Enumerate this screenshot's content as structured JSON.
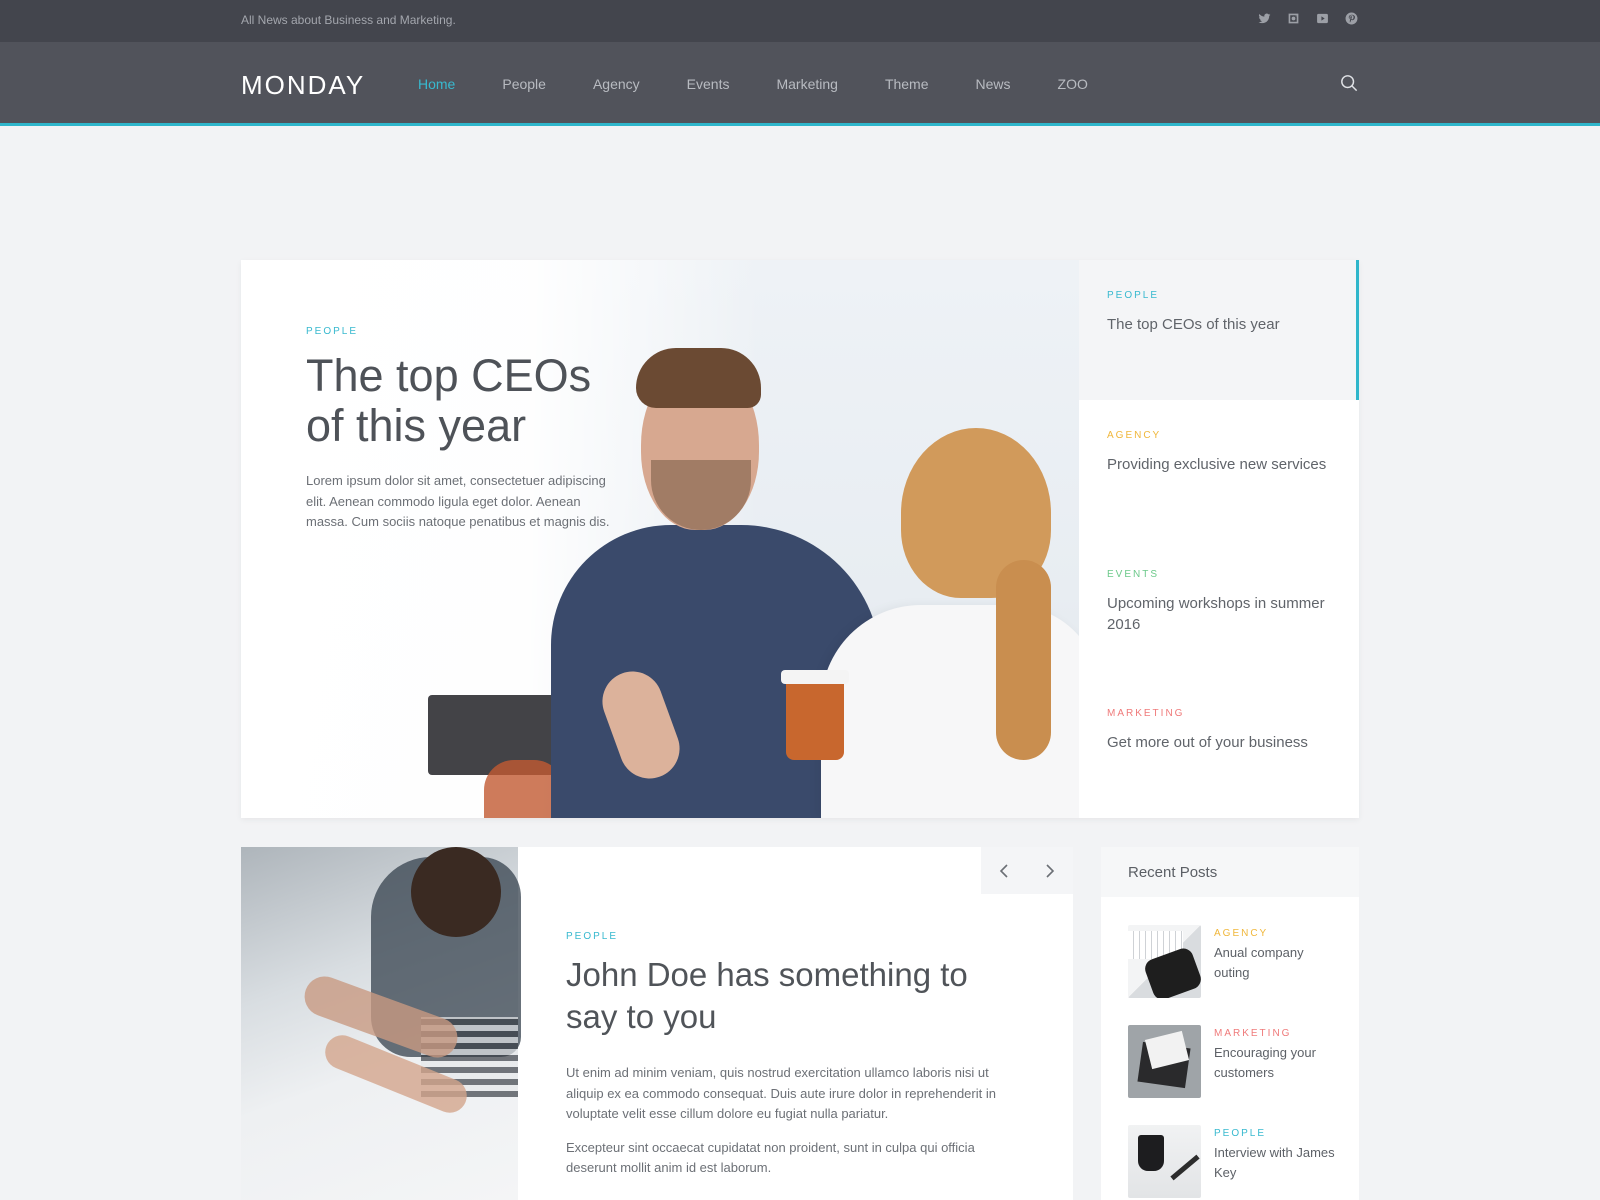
{
  "topbar": {
    "tagline": "All News about Business and Marketing.",
    "social": [
      "twitter-icon",
      "instagram-icon",
      "youtube-icon",
      "pinterest-icon"
    ]
  },
  "nav": {
    "logo": "MONDAY",
    "items": [
      "Home",
      "People",
      "Agency",
      "Events",
      "Marketing",
      "Theme",
      "News",
      "ZOO"
    ],
    "active": "Home",
    "search_icon": "search-icon"
  },
  "colors": {
    "accent": "#2fb6cb",
    "people": "#38b9cf",
    "agency": "#f0b73b",
    "events": "#6cc98a",
    "marketing": "#ef7a7a"
  },
  "hero": {
    "category": "PEOPLE",
    "title": "The top CEOs of this year",
    "excerpt": "Lorem ipsum dolor sit amet, consectetuer adipiscing elit. Aenean commodo ligula eget dolor. Aenean massa. Cum sociis natoque penatibus et magnis dis.",
    "side": [
      {
        "category": "PEOPLE",
        "title": "The top CEOs of this year",
        "active": true
      },
      {
        "category": "AGENCY",
        "title": "Providing exclusive new services",
        "active": false
      },
      {
        "category": "EVENTS",
        "title": "Upcoming workshops in summer 2016",
        "active": false
      },
      {
        "category": "MARKETING",
        "title": "Get more out of your business",
        "active": false
      }
    ]
  },
  "article": {
    "category": "PEOPLE",
    "title": "John Doe has something to say to you",
    "paragraphs": [
      "Ut enim ad minim veniam, quis nostrud exercitation ullamco laboris nisi ut aliquip ex ea commodo consequat. Duis aute irure dolor in reprehenderit in voluptate velit esse cillum dolore eu fugiat nulla pariatur.",
      "Excepteur sint occaecat cupidatat non proident, sunt in culpa qui officia deserunt mollit anim id est laborum."
    ],
    "prev_icon": "chevron-left-icon",
    "next_icon": "chevron-right-icon"
  },
  "recent": {
    "heading": "Recent Posts",
    "posts": [
      {
        "category": "AGENCY",
        "title": "Anual company outing"
      },
      {
        "category": "MARKETING",
        "title": "Encouraging your customers"
      },
      {
        "category": "PEOPLE",
        "title": "Interview with James Key"
      }
    ]
  }
}
